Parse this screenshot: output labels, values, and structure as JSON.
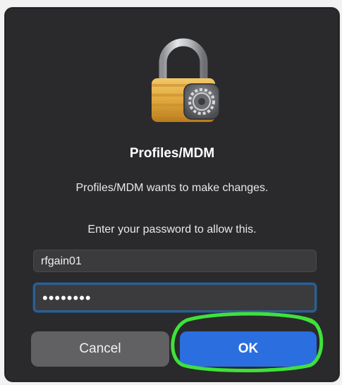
{
  "dialog": {
    "icon": "lock-gear-icon",
    "title": "Profiles/MDM",
    "message": "Profiles/MDM wants to make changes.",
    "instruction": "Enter your password to allow this.",
    "username_value": "rfgain01",
    "password_value": "••••••••",
    "cancel_label": "Cancel",
    "ok_label": "OK"
  },
  "colors": {
    "dialog_bg": "#2a2a2c",
    "ok_button": "#2a6ee0",
    "cancel_button": "#616163",
    "focus_ring": "#2f5f8f",
    "annotation_ring": "#3fe23a"
  }
}
